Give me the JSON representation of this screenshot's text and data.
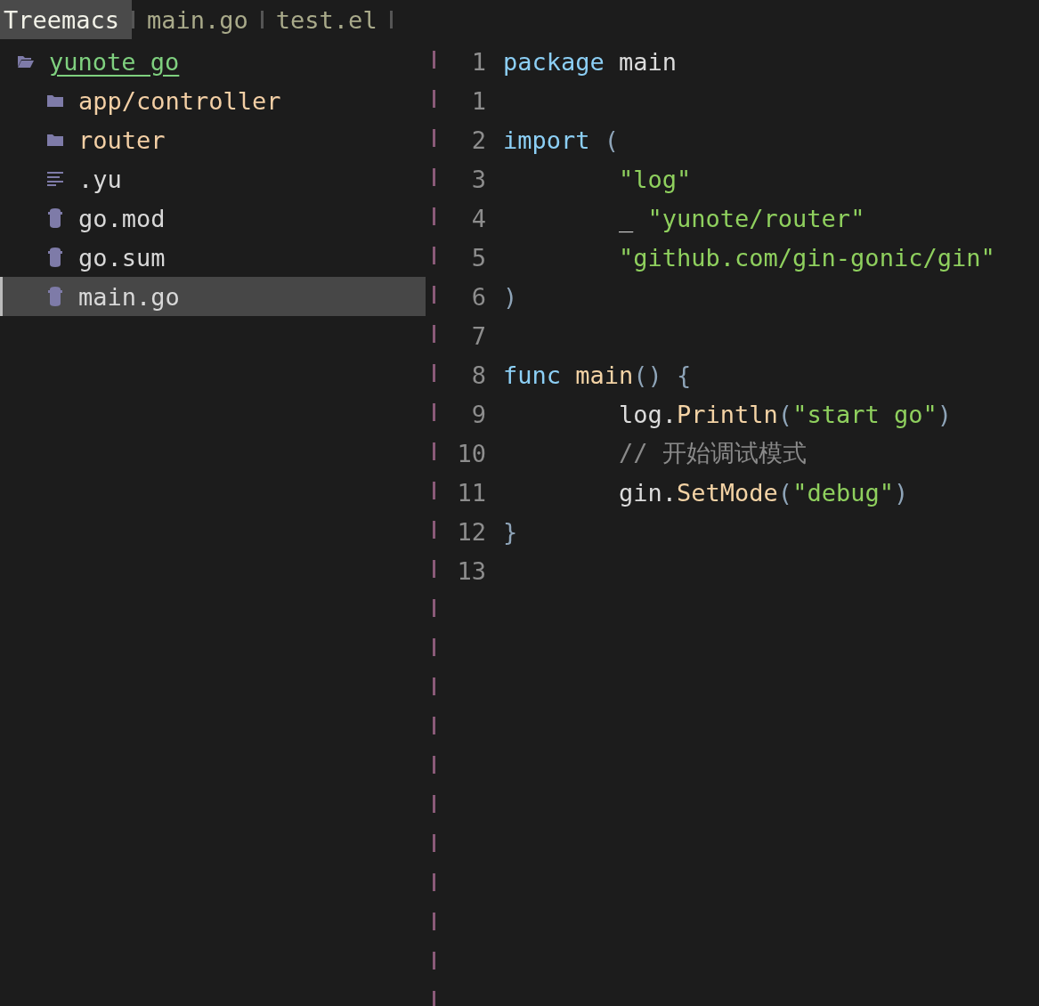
{
  "tabs": [
    {
      "label": "Treemacs",
      "selected": true
    },
    {
      "label": "main.go",
      "selected": false
    },
    {
      "label": "test.el",
      "selected": false
    }
  ],
  "tree": {
    "root": {
      "name": "yunote_go",
      "expanded": true,
      "children": [
        {
          "name": "app/controller",
          "kind": "folder",
          "selected": false
        },
        {
          "name": "router",
          "kind": "folder",
          "selected": false
        },
        {
          "name": ".yu",
          "kind": "text",
          "selected": false
        },
        {
          "name": "go.mod",
          "kind": "go",
          "selected": false
        },
        {
          "name": "go.sum",
          "kind": "go",
          "selected": false
        },
        {
          "name": "main.go",
          "kind": "go",
          "selected": true
        }
      ]
    }
  },
  "editor": {
    "lines": [
      {
        "number": "1",
        "indent": false,
        "tokens": [
          {
            "kind": "keyword",
            "text": "package"
          },
          {
            "kind": "plain",
            "text": " main"
          }
        ]
      },
      {
        "number": "1"
      },
      {
        "number": "2",
        "indent": false,
        "tokens": [
          {
            "kind": "keyword",
            "text": "import"
          },
          {
            "kind": "punct",
            "text": " ("
          }
        ]
      },
      {
        "number": "3",
        "indent": true,
        "tokens": [
          {
            "kind": "string",
            "text": "\"log\""
          }
        ]
      },
      {
        "number": "4",
        "indent": true,
        "tokens": [
          {
            "kind": "plain",
            "text": "_"
          },
          {
            "kind": "string",
            "text": " \"yunote/router\""
          }
        ]
      },
      {
        "number": "5",
        "indent": true,
        "tokens": [
          {
            "kind": "string",
            "text": "\"github.com/gin-gonic/gin\""
          }
        ]
      },
      {
        "number": "6",
        "indent": false,
        "tokens": [
          {
            "kind": "punct",
            "text": ")"
          }
        ]
      },
      {
        "number": "7"
      },
      {
        "number": "8",
        "indent": false,
        "tokens": [
          {
            "kind": "keyword",
            "text": "func"
          },
          {
            "kind": "function",
            "text": " main"
          },
          {
            "kind": "punct",
            "text": "() {"
          }
        ]
      },
      {
        "number": "9",
        "indent": true,
        "tokens": [
          {
            "kind": "plain",
            "text": "log."
          },
          {
            "kind": "function",
            "text": "Println"
          },
          {
            "kind": "punct",
            "text": "("
          },
          {
            "kind": "string",
            "text": "\"start go\""
          },
          {
            "kind": "punct",
            "text": ")"
          }
        ]
      },
      {
        "number": "10",
        "indent": true,
        "tokens": [
          {
            "kind": "comment",
            "text": "// 开始调试模式"
          }
        ]
      },
      {
        "number": "11",
        "indent": true,
        "tokens": [
          {
            "kind": "plain",
            "text": "gin."
          },
          {
            "kind": "function",
            "text": "SetMode"
          },
          {
            "kind": "punct",
            "text": "("
          },
          {
            "kind": "string",
            "text": "\"debug\""
          },
          {
            "kind": "punct",
            "text": ")"
          }
        ]
      },
      {
        "number": "12",
        "indent": false,
        "tokens": [
          {
            "kind": "punct",
            "text": "}"
          }
        ]
      },
      {
        "number": "13"
      }
    ]
  }
}
